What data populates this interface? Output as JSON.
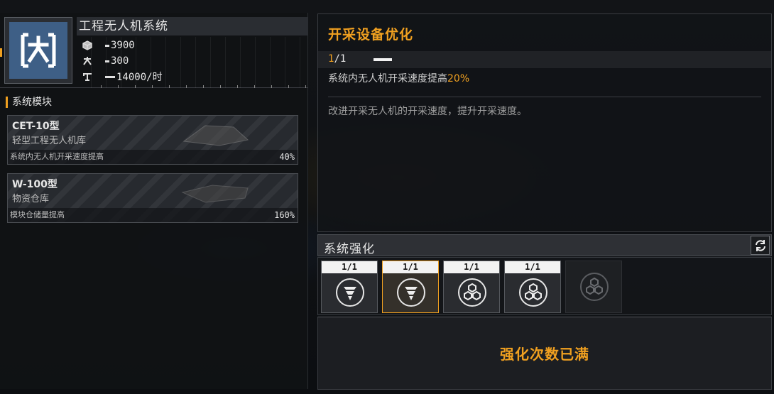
{
  "system": {
    "title": "工程无人机系统",
    "stats": [
      {
        "icon": "cube-icon",
        "value": "3900"
      },
      {
        "icon": "drone-icon",
        "value": "300"
      },
      {
        "icon": "mining-rate-icon",
        "value": "14000/时"
      }
    ]
  },
  "modules": {
    "heading": "系统模块",
    "items": [
      {
        "name": "CET-10型",
        "subtitle": "轻型工程无人机库",
        "desc": "系统内无人机开采速度提高",
        "pct": "40%"
      },
      {
        "name": "W-100型",
        "subtitle": "物资仓库",
        "desc": "模块仓储量提高",
        "pct": "160%"
      }
    ]
  },
  "detail": {
    "title": "开采设备优化",
    "level_current": "1",
    "level_sep_max": "/1",
    "level_fraction": 1.0,
    "effect_prefix": "系统内无人机开采速度提高",
    "effect_value": "20%",
    "description": "改进开采无人机的开采速度，提升开采速度。"
  },
  "enhance": {
    "title": "系统强化",
    "slots": [
      {
        "count": "1/1",
        "icon": "drill-icon",
        "selected": false
      },
      {
        "count": "1/1",
        "icon": "drill-icon",
        "selected": true
      },
      {
        "count": "1/1",
        "icon": "hex-cluster-icon",
        "selected": false
      },
      {
        "count": "1/1",
        "icon": "hex-cluster-icon",
        "selected": false
      },
      {
        "count": "",
        "icon": "hex-cluster-icon",
        "selected": false,
        "empty": true
      }
    ],
    "status": "强化次数已满"
  },
  "colors": {
    "accent": "#f0a020",
    "icon_bg": "#3e5f86"
  }
}
